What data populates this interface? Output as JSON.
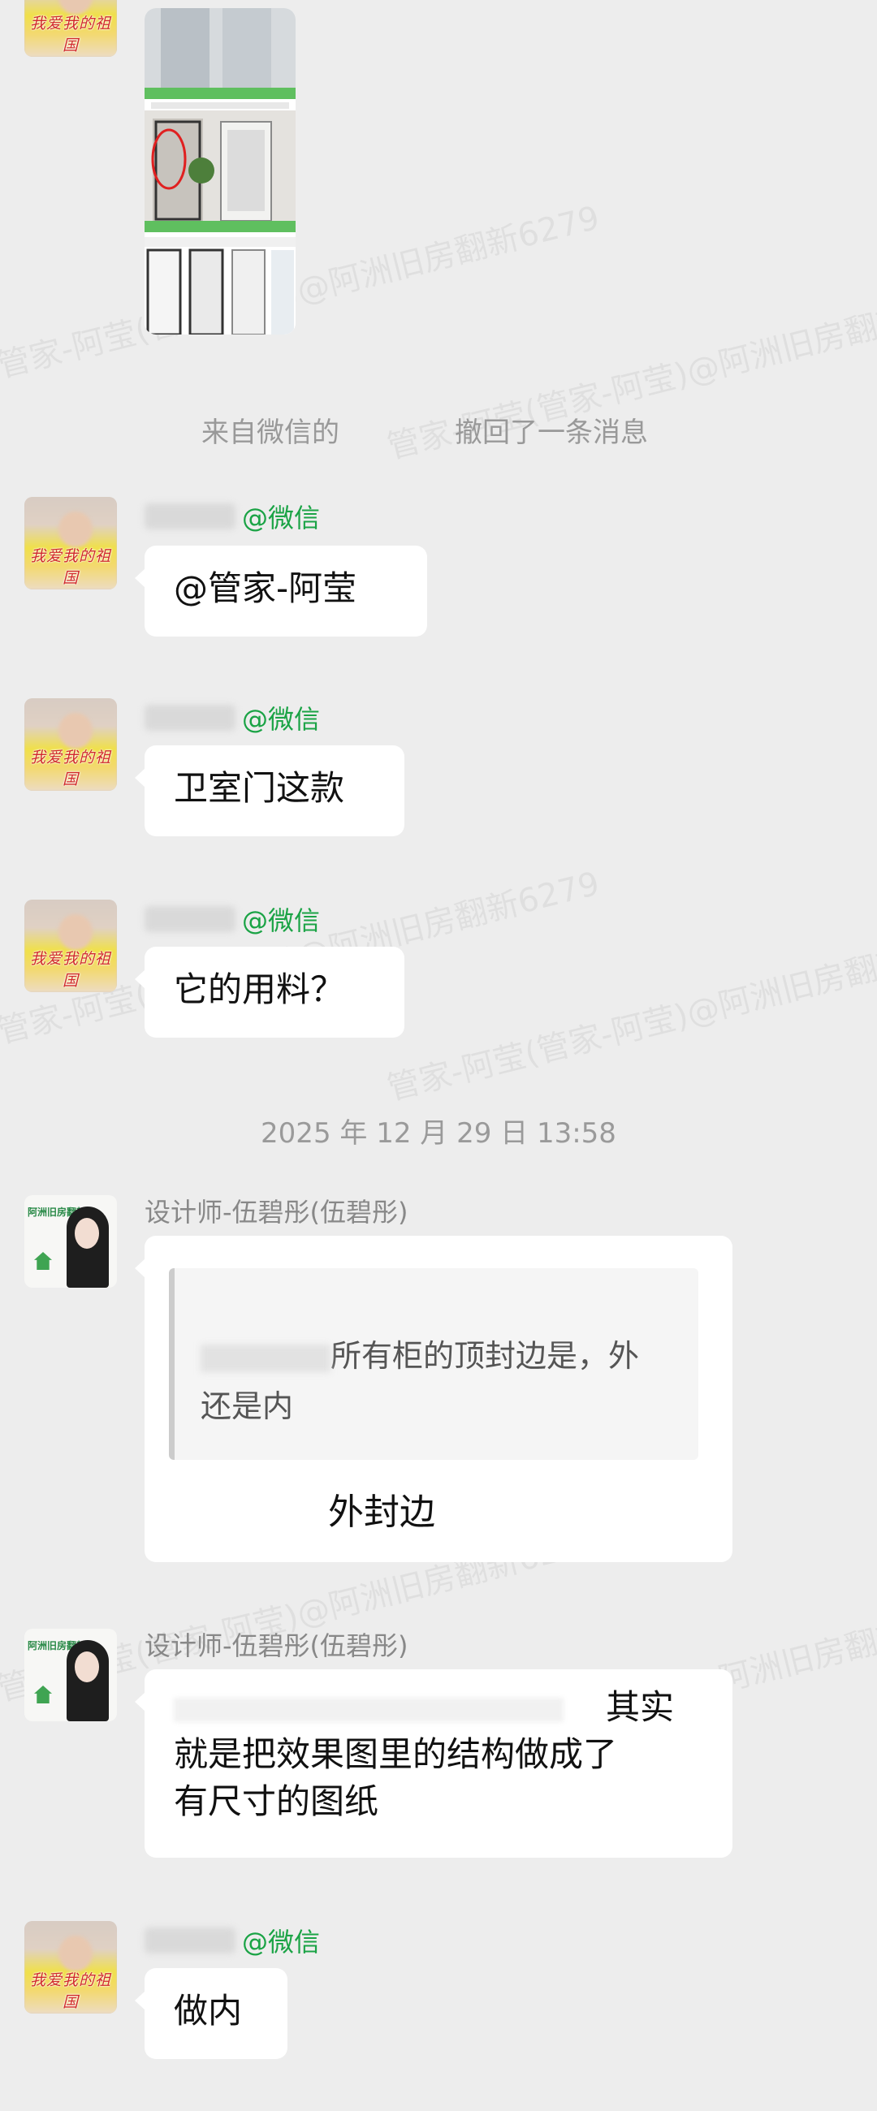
{
  "system": {
    "source_app": "来自微信的",
    "recalled": "撤回了一条消息"
  },
  "timestamp": "2025 年 12 月 29 日  13:58",
  "avatar_caption": "我爱我的祖国",
  "designer_avatar_logo": "阿洲旧房翻新",
  "wechat_tag": "@微信",
  "watermark_text": "管家-阿莹(管家-阿莹)@阿洲旧房翻新6279",
  "messages": {
    "m1": "@管家-阿莹",
    "m2": "卫室门这款",
    "m3": "它的用料？",
    "m4": {
      "sender": "设计师-伍碧彤(伍碧彤)",
      "quote_line1": "所有柜的顶封边是，外",
      "quote_line2": "还是内",
      "reply": "外封边"
    },
    "m5": {
      "sender": "设计师-伍碧彤(伍碧彤)",
      "line1": "其实",
      "line2": "就是把效果图里的结构做成了",
      "line3": "有尺寸的图纸"
    },
    "m6": "做内"
  },
  "colors": {
    "background": "#ededed",
    "bubble": "#ffffff",
    "wechat_green": "#1aa345",
    "system_text": "#999999",
    "quote_bg": "#f5f5f5"
  }
}
